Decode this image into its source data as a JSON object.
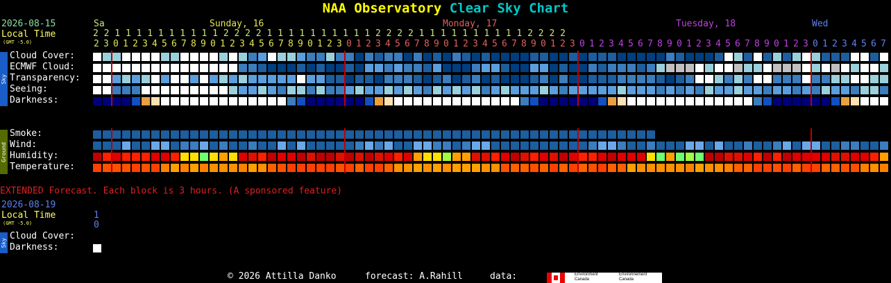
{
  "header": {
    "title_part1": "NAA Observatory",
    "title_part2": "Clear Sky Chart"
  },
  "top": {
    "date": "2026-08-15",
    "local_time": "Local Time",
    "gmt": "(GMT -5.0)",
    "days": [
      {
        "label": "Sa",
        "color": "#c8e878"
      },
      {
        "label": "Sunday, 16",
        "color": "#e6e650"
      },
      {
        "label": "Monday, 17",
        "color": "#e06060"
      },
      {
        "label": "Tuesday, 18",
        "color": "#c040e0"
      },
      {
        "label": "Wed",
        "color": "#6080f0"
      }
    ],
    "tens_row": "2 2                 1 1 1 1 1 1 1 1 1 1 2 2 2 2                 1 1 1 1 1 1 1 1 1 1 2 2 2 2                 1 1 1 1 1 1 1 1 1 1 2 2 2 2",
    "hours": [
      "2",
      "3",
      "0",
      "1",
      "2",
      "3",
      "4",
      "5",
      "6",
      "7",
      "8",
      "9",
      "0",
      "1",
      "2",
      "3",
      "4",
      "5",
      "6",
      "7",
      "8",
      "9",
      "0",
      "1",
      "2",
      "3",
      "0",
      "1",
      "2",
      "3",
      "4",
      "5",
      "6",
      "7",
      "8",
      "9",
      "0",
      "1",
      "2",
      "3",
      "4",
      "5",
      "6",
      "7",
      "8",
      "9",
      "0",
      "1",
      "2",
      "3",
      "0",
      "1",
      "2",
      "3",
      "4",
      "5",
      "6",
      "7",
      "8",
      "9",
      "0",
      "1",
      "2",
      "3",
      "4",
      "5",
      "6",
      "7",
      "8",
      "9",
      "0",
      "1",
      "2",
      "3",
      "0",
      "1",
      "2",
      "3",
      "4",
      "5",
      "6",
      "7"
    ]
  },
  "rows_sky": {
    "sidebar": "Sky",
    "labels": [
      "Cloud Cover:",
      "ECMWF Cloud:",
      "Transparency:",
      "Seeing:",
      "Darkness:"
    ]
  },
  "rows_ground": {
    "sidebar": "Ground",
    "labels": [
      "Smoke:",
      "Wind:",
      "Humidity:",
      "Temperature:"
    ]
  },
  "extended": {
    "note": "EXTENDED Forecast. Each block is 3 hours. (A sponsored feature)",
    "date": "2026-08-19",
    "local_time": "Local Time",
    "gmt": "(GMT -5.0)",
    "hour_top": "1",
    "hour_bottom": "0",
    "sidebar": "Sky",
    "labels": [
      "Cloud Cover:",
      "Darkness:"
    ]
  },
  "footer": {
    "copyright": "© 2026 Attilla Danko",
    "forecast": "forecast: A.Rahill",
    "data": "data:",
    "env_en": "Environment Canada",
    "env_fr": "Environnement Canada"
  },
  "colors": {
    "cloud_clear": "#003e7e",
    "cloud_light": "#1c5e9e",
    "cloud_mid": "#3b7dbd",
    "cloud_more": "#5b9ede",
    "cloud_heavy": "#9ad0dc",
    "cloud_over": "#ffffff",
    "midnight_line": "#c00000"
  }
}
